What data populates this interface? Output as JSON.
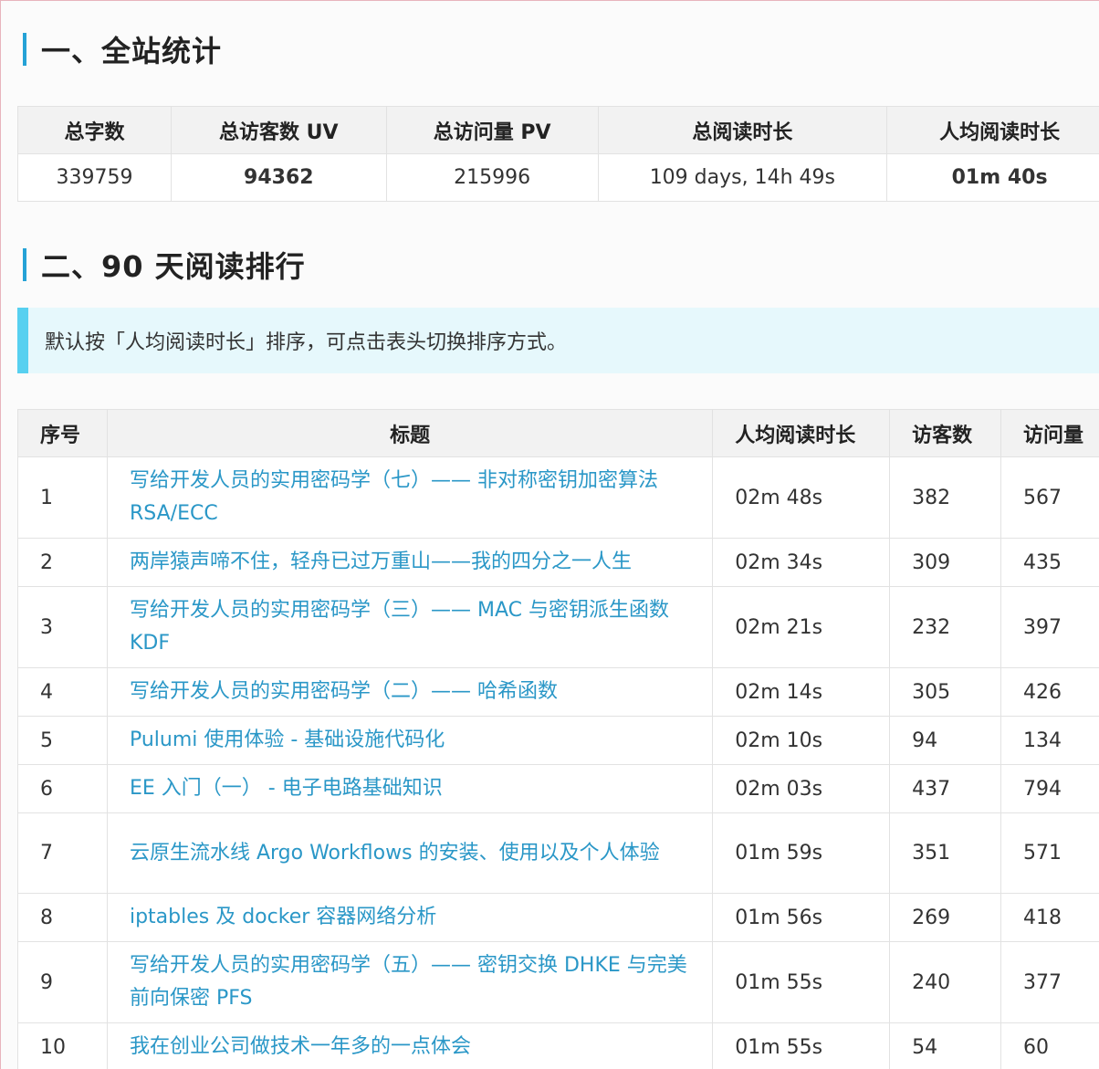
{
  "section1": {
    "title": "一、全站统计"
  },
  "stats": {
    "headers": [
      "总字数",
      "总访客数 UV",
      "总访问量 PV",
      "总阅读时长",
      "人均阅读时长"
    ],
    "values": [
      "339759",
      "94362",
      "215996",
      "109 days, 14h 49s",
      "01m 40s"
    ]
  },
  "section2": {
    "title": "二、90 天阅读排行"
  },
  "note": "默认按「人均阅读时长」排序，可点击表头切换排序方式。",
  "ranking": {
    "headers": [
      "序号",
      "标题",
      "人均阅读时长",
      "访客数",
      "访问量"
    ],
    "rows": [
      {
        "n": "1",
        "title": "写给开发人员的实用密码学（七）—— 非对称密钥加密算法 RSA/ECC",
        "avg": "02m 48s",
        "uv": "382",
        "pv": "567"
      },
      {
        "n": "2",
        "title": "两岸猿声啼不住，轻舟已过万重山——我的四分之一人生",
        "avg": "02m 34s",
        "uv": "309",
        "pv": "435"
      },
      {
        "n": "3",
        "title": "写给开发人员的实用密码学（三）—— MAC 与密钥派生函数 KDF",
        "avg": "02m 21s",
        "uv": "232",
        "pv": "397"
      },
      {
        "n": "4",
        "title": "写给开发人员的实用密码学（二）—— 哈希函数",
        "avg": "02m 14s",
        "uv": "305",
        "pv": "426"
      },
      {
        "n": "5",
        "title": "Pulumi 使用体验 - 基础设施代码化",
        "avg": "02m 10s",
        "uv": "94",
        "pv": "134"
      },
      {
        "n": "6",
        "title": "EE 入门（一） - 电子电路基础知识",
        "avg": "02m 03s",
        "uv": "437",
        "pv": "794"
      },
      {
        "n": "7",
        "title": "云原生流水线 Argo Workflows 的安装、使用以及个人体验",
        "avg": "01m 59s",
        "uv": "351",
        "pv": "571"
      },
      {
        "n": "8",
        "title": "iptables 及 docker 容器网络分析",
        "avg": "01m 56s",
        "uv": "269",
        "pv": "418"
      },
      {
        "n": "9",
        "title": "写给开发人员的实用密码学（五）—— 密钥交换 DHKE 与完美前向保密 PFS",
        "avg": "01m 55s",
        "uv": "240",
        "pv": "377"
      },
      {
        "n": "10",
        "title": "我在创业公司做技术一年多的一点体会",
        "avg": "01m 55s",
        "uv": "54",
        "pv": "60"
      }
    ]
  }
}
